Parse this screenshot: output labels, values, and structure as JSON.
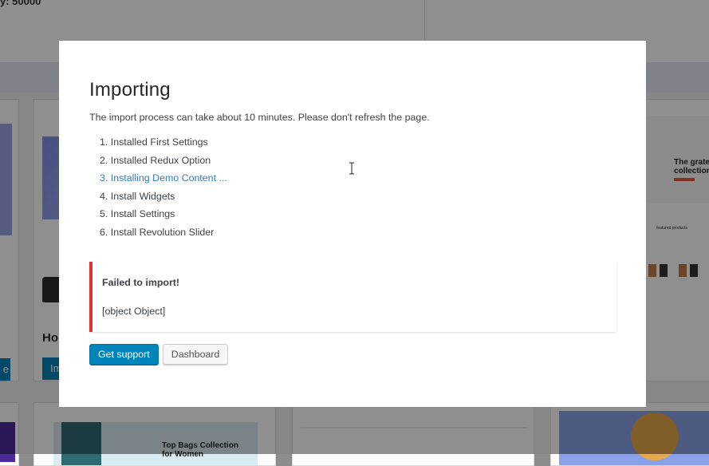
{
  "background": {
    "header_text": "y: 50000",
    "left_card_title": "Ho",
    "left_card_button": "e",
    "mid_card_button": "Im",
    "right_card_heading": "The grates collection",
    "right_card_section": "featured products",
    "bottom_card_heading": "Top Bags Collection for Women"
  },
  "modal": {
    "title": "Importing",
    "description": "The import process can take about 10 minutes. Please don't refresh the page.",
    "steps": [
      "1. Installed First Settings",
      "2. Installed Redux Option",
      "3. Installing Demo Content ...",
      "4. Install Widgets",
      "5. Install Settings",
      "6. Install Revolution Slider"
    ],
    "error": {
      "title": "Failed to import!",
      "message": "[object Object]"
    },
    "buttons": {
      "support": "Get support",
      "dashboard": "Dashboard"
    }
  },
  "colors": {
    "accent": "#0085ba",
    "active_step": "#2f7cbf",
    "error_border": "#dc3232"
  }
}
